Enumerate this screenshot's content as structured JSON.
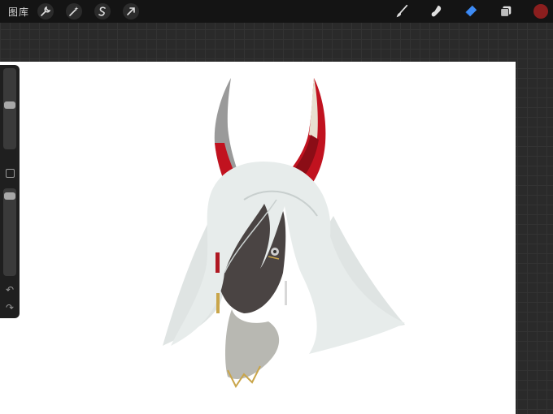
{
  "toolbar": {
    "gallery_label": "图库",
    "left_tools": [
      {
        "name": "actions",
        "icon": "wrench-icon"
      },
      {
        "name": "adjustments",
        "icon": "magic-wand-icon"
      },
      {
        "name": "selection",
        "icon": "selection-s-icon"
      },
      {
        "name": "transform",
        "icon": "arrow-icon"
      }
    ],
    "right_tools": [
      {
        "name": "brush",
        "icon": "brush-icon",
        "active": false
      },
      {
        "name": "smudge",
        "icon": "smudge-icon",
        "active": false
      },
      {
        "name": "eraser",
        "icon": "eraser-icon",
        "active": true
      },
      {
        "name": "layers",
        "icon": "layers-icon",
        "active": false
      }
    ],
    "current_color": "#8b1e1e",
    "active_tool_color": "#3d8bf5"
  },
  "sidebar": {
    "brush_size_level": 0.55,
    "opacity_level": 0.95,
    "modify_icon": "square-icon",
    "undo_icon": "undo-icon",
    "redo_icon": "redo-icon"
  },
  "canvas": {
    "background": "#ffffff",
    "artwork": "illustration"
  }
}
